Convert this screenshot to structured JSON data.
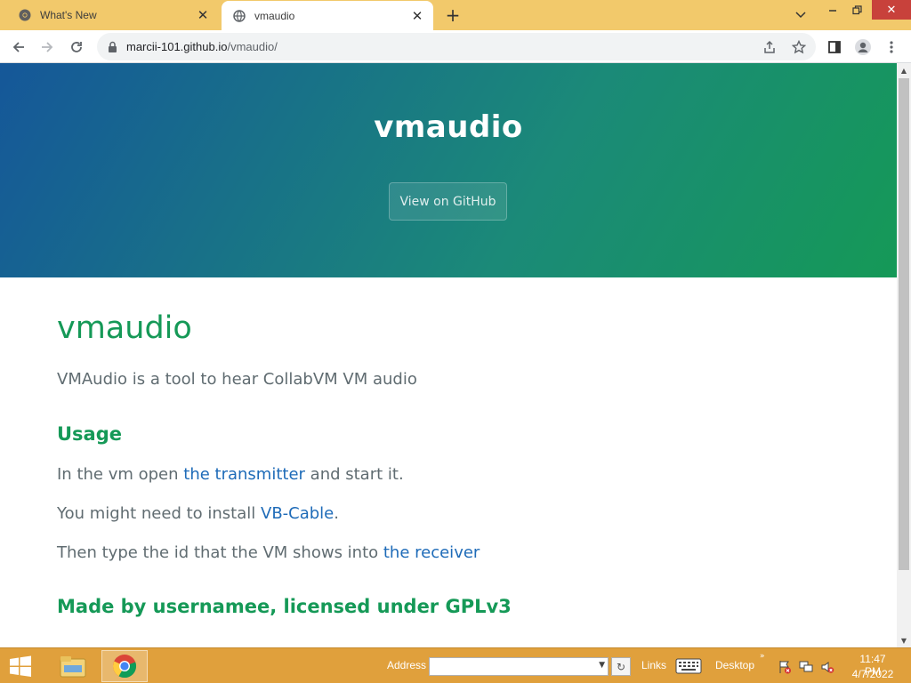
{
  "browser": {
    "tabs": [
      {
        "title": "What's New",
        "icon": "chrome-icon",
        "active": false
      },
      {
        "title": "vmaudio",
        "icon": "globe-icon",
        "active": true
      }
    ],
    "url_host": "marcii-101.github.io",
    "url_path": "/vmaudio/"
  },
  "hero": {
    "title": "vmaudio",
    "button_label": "View on GitHub"
  },
  "content": {
    "heading": "vmaudio",
    "intro": "VMAudio is a tool to hear CollabVM VM audio",
    "usage_heading": "Usage",
    "p1_before": "In the vm open ",
    "p1_link": "the transmitter",
    "p1_after": " and start it.",
    "p2_before": "You might need to install ",
    "p2_link": "VB-Cable",
    "p2_after": ".",
    "p3_before": "Then type the id that the VM shows into ",
    "p3_link": "the receiver",
    "footer_heading": "Made by usernamee, licensed under GPLv3"
  },
  "taskbar": {
    "address_label": "Address",
    "address_value": "",
    "links_label": "Links",
    "desktop_label": "Desktop",
    "time": "11:47 PM",
    "date": "4/7/2022"
  },
  "colors": {
    "tabstrip": "#f2c96b",
    "hero_start": "#155799",
    "hero_end": "#159957",
    "heading_green": "#159957",
    "body_text": "#606c71",
    "link_blue": "#1e6bb8",
    "taskbar": "#e0a03c"
  }
}
